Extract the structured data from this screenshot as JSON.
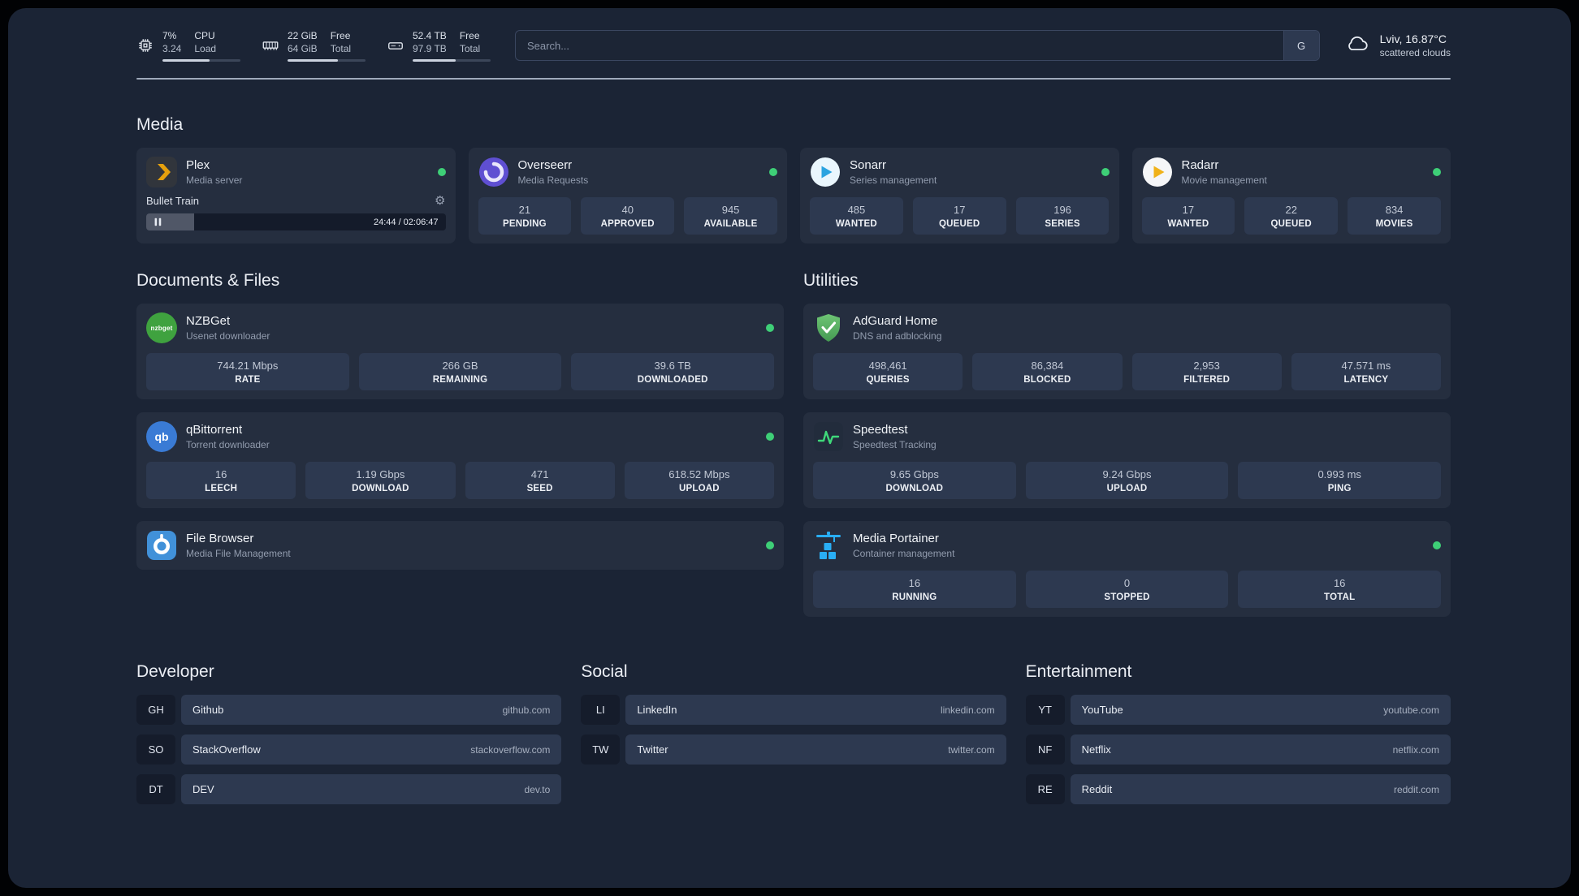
{
  "colors": {
    "status_online": "#3ecf77",
    "accent_plex": "#e5a00d",
    "accent_overseerr": "#5f4fd2",
    "accent_sonarr": "#2ba3e0",
    "accent_radarr": "#f0b21a",
    "accent_nzbget": "#3fa23f",
    "accent_qbittorrent": "#3a7bd5",
    "accent_adguard": "#58b666",
    "accent_speedtest": "#3fd97a",
    "accent_portainer": "#29aef5"
  },
  "topbar": {
    "stats": [
      {
        "icon": "cpu-icon",
        "value": "7%",
        "value2": "3.24",
        "label": "CPU",
        "label2": "Load",
        "progress": 60
      },
      {
        "icon": "ram-icon",
        "value": "22 GiB",
        "value2": "64 GiB",
        "label": "Free",
        "label2": "Total",
        "progress": 65
      },
      {
        "icon": "disk-icon",
        "value": "52.4 TB",
        "value2": "97.9 TB",
        "label": "Free",
        "label2": "Total",
        "progress": 55
      }
    ],
    "search": {
      "placeholder": "Search...",
      "engine_label": "G"
    },
    "weather": {
      "icon": "cloud-icon",
      "location": "Lviv, 16.87°C",
      "condition": "scattered clouds"
    }
  },
  "sections": {
    "media": {
      "title": "Media",
      "apps": [
        {
          "icon": "plex-icon",
          "name": "Plex",
          "desc": "Media server",
          "status": "online",
          "player": {
            "track": "Bullet Train",
            "time": "24:44 / 02:06:47",
            "progress": 16
          }
        },
        {
          "icon": "overseerr-icon",
          "name": "Overseerr",
          "desc": "Media Requests",
          "status": "online",
          "stats": [
            {
              "value": "21",
              "label": "PENDING"
            },
            {
              "value": "40",
              "label": "APPROVED"
            },
            {
              "value": "945",
              "label": "AVAILABLE"
            }
          ]
        },
        {
          "icon": "sonarr-icon",
          "name": "Sonarr",
          "desc": "Series management",
          "status": "online",
          "stats": [
            {
              "value": "485",
              "label": "WANTED"
            },
            {
              "value": "17",
              "label": "QUEUED"
            },
            {
              "value": "196",
              "label": "SERIES"
            }
          ]
        },
        {
          "icon": "radarr-icon",
          "name": "Radarr",
          "desc": "Movie management",
          "status": "online",
          "stats": [
            {
              "value": "17",
              "label": "WANTED"
            },
            {
              "value": "22",
              "label": "QUEUED"
            },
            {
              "value": "834",
              "label": "MOVIES"
            }
          ]
        }
      ]
    },
    "documents": {
      "title": "Documents & Files",
      "apps": [
        {
          "icon": "nzbget-icon",
          "name": "NZBGet",
          "desc": "Usenet downloader",
          "status": "online",
          "stats": [
            {
              "value": "744.21 Mbps",
              "label": "RATE"
            },
            {
              "value": "266 GB",
              "label": "REMAINING"
            },
            {
              "value": "39.6 TB",
              "label": "DOWNLOADED"
            }
          ]
        },
        {
          "icon": "qbittorrent-icon",
          "name": "qBittorrent",
          "desc": "Torrent downloader",
          "status": "online",
          "stats": [
            {
              "value": "16",
              "label": "LEECH"
            },
            {
              "value": "1.19 Gbps",
              "label": "DOWNLOAD"
            },
            {
              "value": "471",
              "label": "SEED"
            },
            {
              "value": "618.52 Mbps",
              "label": "UPLOAD"
            }
          ]
        },
        {
          "icon": "filebrowser-icon",
          "name": "File Browser",
          "desc": "Media File Management",
          "status": "online"
        }
      ]
    },
    "utilities": {
      "title": "Utilities",
      "apps": [
        {
          "icon": "adguard-icon",
          "name": "AdGuard Home",
          "desc": "DNS and adblocking",
          "stats": [
            {
              "value": "498,461",
              "label": "QUERIES"
            },
            {
              "value": "86,384",
              "label": "BLOCKED"
            },
            {
              "value": "2,953",
              "label": "FILTERED"
            },
            {
              "value": "47.571 ms",
              "label": "LATENCY"
            }
          ]
        },
        {
          "icon": "speedtest-icon",
          "name": "Speedtest",
          "desc": "Speedtest Tracking",
          "stats": [
            {
              "value": "9.65 Gbps",
              "label": "DOWNLOAD"
            },
            {
              "value": "9.24 Gbps",
              "label": "UPLOAD"
            },
            {
              "value": "0.993 ms",
              "label": "PING"
            }
          ]
        },
        {
          "icon": "portainer-icon",
          "name": "Media Portainer",
          "desc": "Container management",
          "status": "online",
          "stats": [
            {
              "value": "16",
              "label": "RUNNING"
            },
            {
              "value": "0",
              "label": "STOPPED"
            },
            {
              "value": "16",
              "label": "TOTAL"
            }
          ]
        }
      ]
    },
    "developer": {
      "title": "Developer",
      "items": [
        {
          "abbr": "GH",
          "name": "Github",
          "url": "github.com"
        },
        {
          "abbr": "SO",
          "name": "StackOverflow",
          "url": "stackoverflow.com"
        },
        {
          "abbr": "DT",
          "name": "DEV",
          "url": "dev.to"
        }
      ]
    },
    "social": {
      "title": "Social",
      "items": [
        {
          "abbr": "LI",
          "name": "LinkedIn",
          "url": "linkedin.com"
        },
        {
          "abbr": "TW",
          "name": "Twitter",
          "url": "twitter.com"
        }
      ]
    },
    "entertainment": {
      "title": "Entertainment",
      "items": [
        {
          "abbr": "YT",
          "name": "YouTube",
          "url": "youtube.com"
        },
        {
          "abbr": "NF",
          "name": "Netflix",
          "url": "netflix.com"
        },
        {
          "abbr": "RE",
          "name": "Reddit",
          "url": "reddit.com"
        }
      ]
    }
  }
}
